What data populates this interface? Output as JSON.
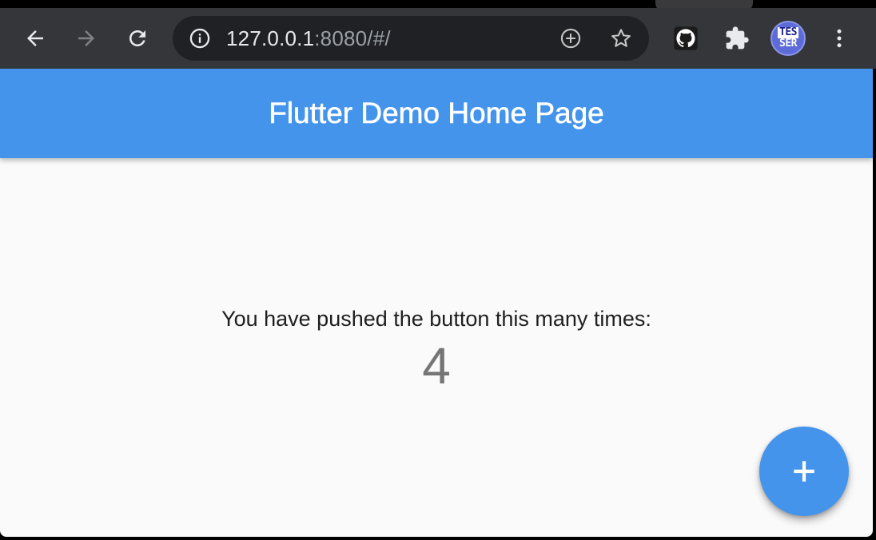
{
  "browser": {
    "url_host": "127.0.0.1",
    "url_rest": ":8080/#/",
    "profile_avatar": {
      "line1": "TES",
      "line2": "SER"
    },
    "icons": {
      "back": "back-arrow-icon",
      "forward": "forward-arrow-icon",
      "reload": "reload-icon",
      "site_info": "info-icon",
      "add": "add-circle-icon",
      "bookmark": "star-icon",
      "github": "github-icon",
      "extensions": "puzzle-icon",
      "menu": "kebab-menu-icon"
    }
  },
  "app": {
    "title": "Flutter Demo Home Page",
    "counter_label": "You have pushed the button this many times:",
    "counter_value": "4",
    "fab_icon": "plus-icon"
  },
  "colors": {
    "primary": "#4494ec",
    "toolbar": "#35363a",
    "omnibox": "#202124",
    "page_bg": "#fafafa"
  }
}
